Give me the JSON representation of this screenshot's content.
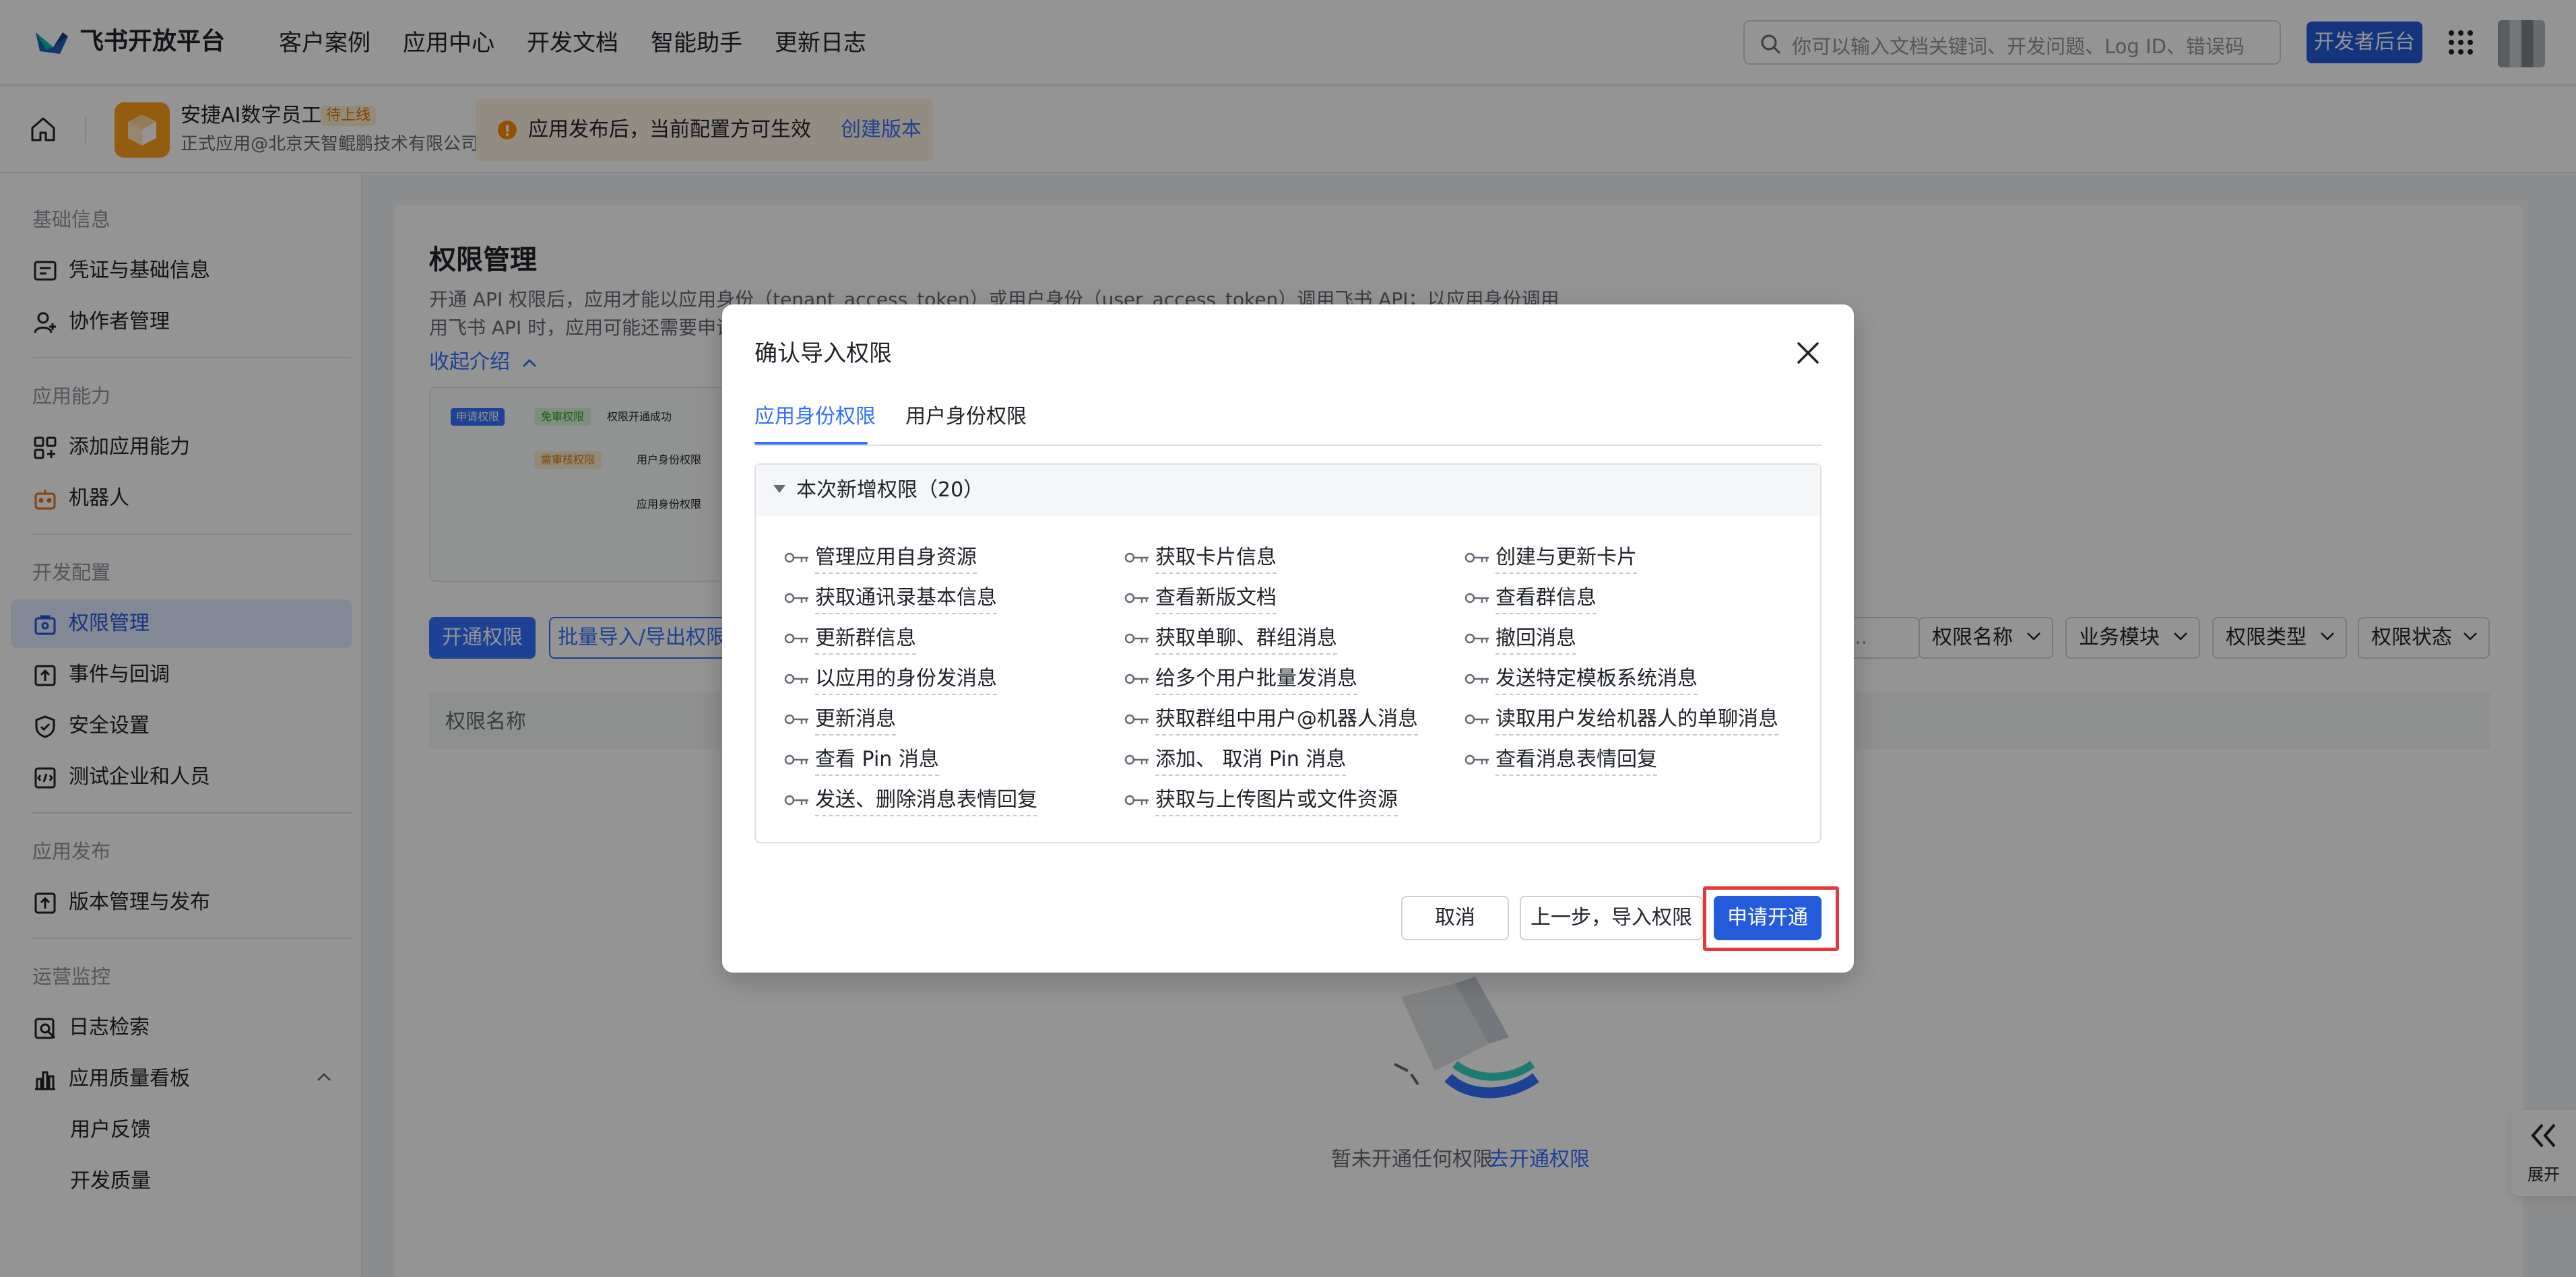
{
  "topnav": {
    "logo": "飞书开放平台",
    "items": [
      "客户案例",
      "应用中心",
      "开发文档",
      "智能助手",
      "更新日志"
    ],
    "search_placeholder": "你可以输入文档关键词、开发问题、Log ID、错误码",
    "dev_console": "开发者后台"
  },
  "app": {
    "name": "安捷AI数字员工",
    "badge": "待上线",
    "subtitle": "正式应用@北京天智鲲鹏技术有限公司",
    "notice": "应用发布后，当前配置方可生效",
    "notice_link": "创建版本"
  },
  "sidebar": {
    "groups": [
      "基础信息",
      "应用能力",
      "开发配置",
      "应用发布",
      "运营监控"
    ],
    "items": [
      {
        "label": "凭证与基础信息",
        "icon": "credential-icon"
      },
      {
        "label": "协作者管理",
        "icon": "user-add-icon"
      },
      {
        "label": "添加应用能力",
        "icon": "apps-add-icon"
      },
      {
        "label": "机器人",
        "icon": "robot-icon"
      },
      {
        "label": "权限管理",
        "icon": "permission-icon"
      },
      {
        "label": "事件与回调",
        "icon": "event-icon"
      },
      {
        "label": "安全设置",
        "icon": "shield-icon"
      },
      {
        "label": "测试企业和人员",
        "icon": "test-icon"
      },
      {
        "label": "版本管理与发布",
        "icon": "upload-icon"
      },
      {
        "label": "日志检索",
        "icon": "log-search-icon"
      },
      {
        "label": "应用质量看板",
        "icon": "bar-chart-icon"
      }
    ],
    "subitems": [
      "用户反馈",
      "开发质量"
    ]
  },
  "main": {
    "title": "权限管理",
    "intro_line1": "开通 API 权限后，应用才能以应用身份（tenant_access_token）或用户身份（user_access_token）调用飞书 API；以应用身份调用",
    "intro_line2": "用飞书 API 时，应用可能还需要申请",
    "collapse": "收起介绍",
    "diagram": {
      "apply": "申请权限",
      "exempt": "免审权限",
      "review": "需审核权限",
      "success": "权限开通成功",
      "user_identity": "用户身份权限",
      "app_identity": "应用身份权限"
    },
    "open_btn": "开通权限",
    "batch_btn": "批量导入/导出权限",
    "search_stub": "r...",
    "filters": [
      "权限名称",
      "业务模块",
      "权限类型",
      "权限状态"
    ],
    "table_header": "权限名称",
    "empty_text": "暂未开通任何权限",
    "empty_link": "去开通权限",
    "expand": "展开"
  },
  "modal": {
    "title": "确认导入权限",
    "tabs": [
      "应用身份权限",
      "用户身份权限"
    ],
    "section_title": "本次新增权限（20）",
    "permissions": [
      "管理应用自身资源",
      "获取卡片信息",
      "创建与更新卡片",
      "获取通讯录基本信息",
      "查看新版文档",
      "查看群信息",
      "更新群信息",
      "获取单聊、群组消息",
      "撤回消息",
      "以应用的身份发消息",
      "给多个用户批量发消息",
      "发送特定模板系统消息",
      "更新消息",
      "获取群组中用户@机器人消息",
      "读取用户发给机器人的单聊消息",
      "查看 Pin 消息",
      "添加、 取消 Pin 消息",
      "查看消息表情回复",
      "发送、删除消息表情回复",
      "获取与上传图片或文件资源"
    ],
    "cancel": "取消",
    "prev": "上一步，导入权限",
    "apply": "申请开通"
  }
}
